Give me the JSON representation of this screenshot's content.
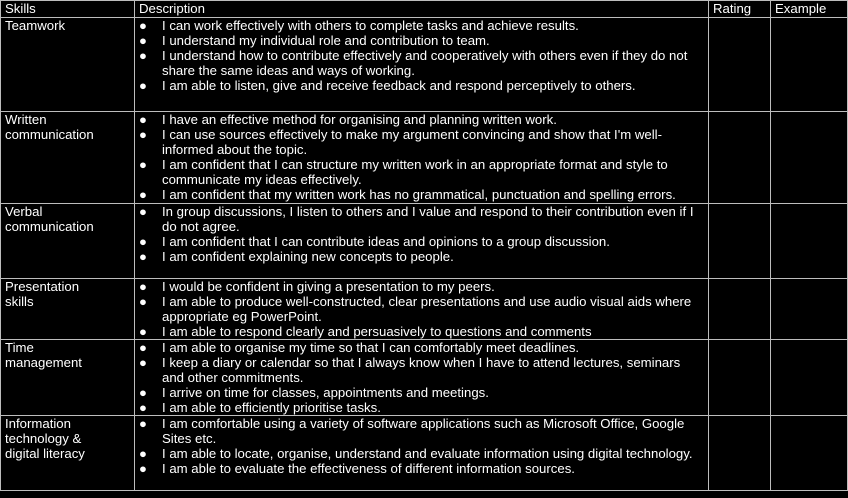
{
  "table": {
    "headers": [
      "Skills",
      "Description",
      "Rating",
      "Example"
    ],
    "bullet": "●",
    "rows": [
      {
        "skill": "Teamwork",
        "items": [
          "I can work effectively with others to complete tasks and achieve results.",
          "I understand my individual role and contribution to team.",
          "I understand how to contribute effectively and cooperatively with others even if they do not share the same ideas and ways of working.",
          "I am able to listen, give and receive feedback and respond perceptively to others."
        ]
      },
      {
        "skill": "Written\ncommunication",
        "items": [
          "I have an effective method for organising and planning written work.",
          "I can use sources effectively to make my argument convincing and show that I'm well-informed about the topic.",
          "I am confident that I can structure my written work in an appropriate format and style to communicate my ideas effectively.",
          "I am confident that my written work has no grammatical, punctuation and spelling errors."
        ]
      },
      {
        "skill": "Verbal\ncommunication",
        "items": [
          "In group discussions, I listen to others and I value and respond to their contribution even if I do not agree.",
          "I am confident that I can contribute ideas and opinions to a group discussion.",
          "I am confident explaining new concepts to people."
        ]
      },
      {
        "skill": "Presentation\nskills",
        "items": [
          "I would be confident in giving a presentation to my peers.",
          "I am able to produce well-constructed, clear presentations and use audio visual aids where appropriate eg PowerPoint.",
          "I am able to respond clearly and persuasively to questions and comments"
        ]
      },
      {
        "skill": "Time\nmanagement",
        "items": [
          "I am able to organise my time so that I can comfortably meet deadlines.",
          "I keep a diary or calendar so that I always know when I have to attend lectures, seminars and other commitments.",
          "I arrive on time for classes, appointments and meetings.",
          "I am able to efficiently prioritise tasks."
        ]
      },
      {
        "skill": "Information\ntechnology &\ndigital literacy",
        "items": [
          "I am comfortable using a variety of software applications such as Microsoft Office, Google Sites etc.",
          "I am able to locate, organise, understand and evaluate information using digital technology.",
          "I am able to evaluate the effectiveness of different information sources."
        ]
      }
    ]
  }
}
